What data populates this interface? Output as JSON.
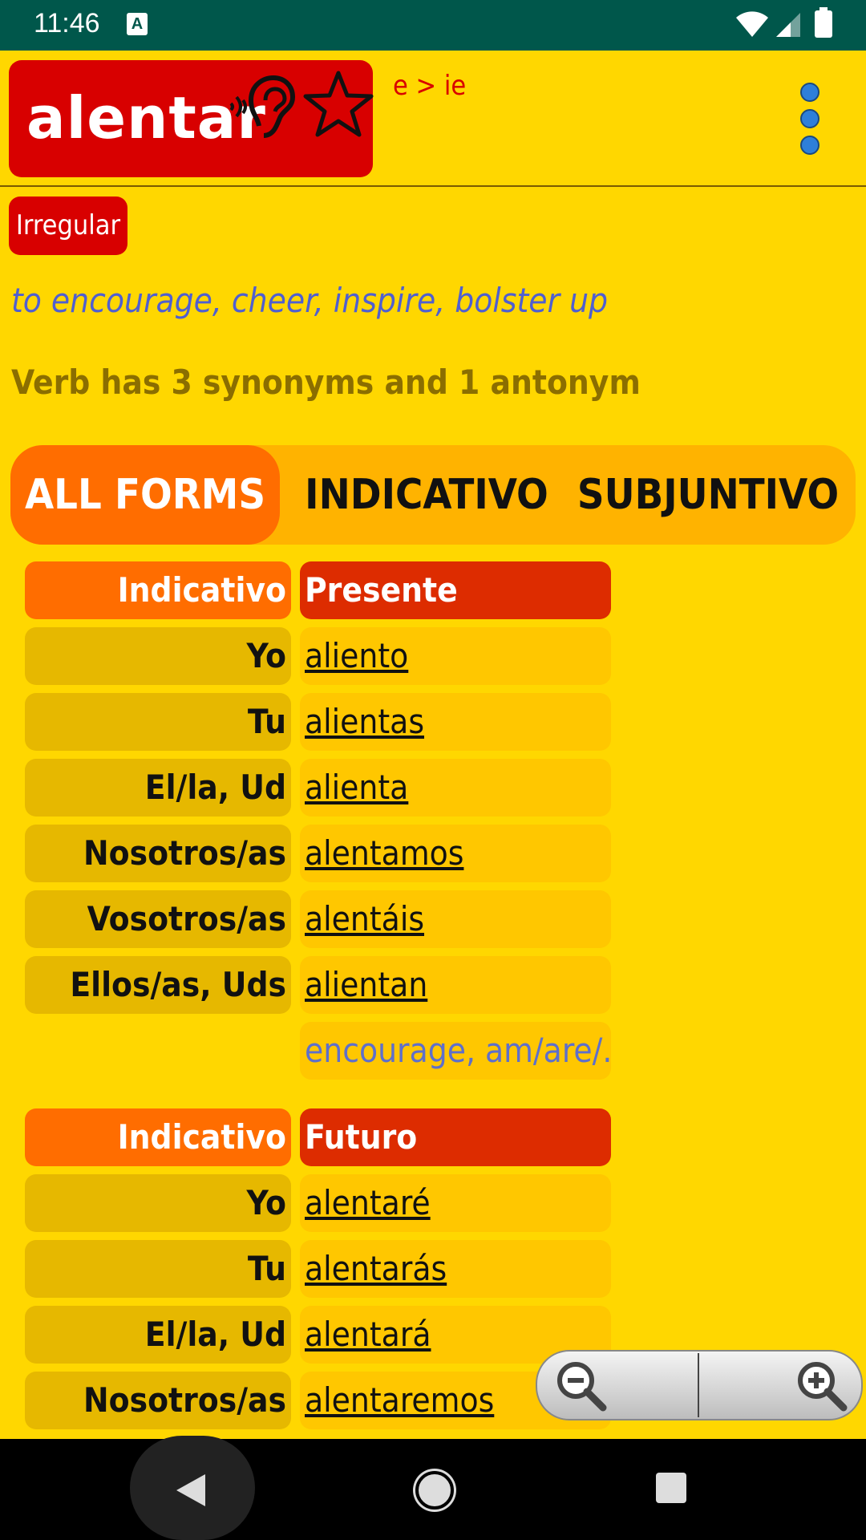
{
  "status_bar": {
    "time": "11:46",
    "notif_icon": "A"
  },
  "header": {
    "verb": "alentar",
    "stem_change": "e > ie"
  },
  "badge": "Irregular",
  "translation": "to encourage, cheer, inspire, bolster up",
  "synonyms_info": "Verb has 3 synonyms and 1 antonym",
  "tabs": [
    {
      "label": "ALL FORMS",
      "active": true
    },
    {
      "label": "INDICATIVO",
      "active": false
    },
    {
      "label": "SUBJUNTIVO",
      "active": false
    }
  ],
  "sections": [
    {
      "mood": "Indicativo",
      "tense": "Presente",
      "rows": [
        {
          "pronoun": "Yo",
          "form": "aliento"
        },
        {
          "pronoun": "Tu",
          "form": "alientas"
        },
        {
          "pronoun": "El/la, Ud",
          "form": "alienta"
        },
        {
          "pronoun": "Nosotros/as",
          "form": "alentamos"
        },
        {
          "pronoun": "Vosotros/as",
          "form": "alentáis"
        },
        {
          "pronoun": "Ellos/as, Uds",
          "form": "alientan"
        }
      ],
      "translation": "encourage, am/are/.."
    },
    {
      "mood": "Indicativo",
      "tense": "Futuro",
      "rows": [
        {
          "pronoun": "Yo",
          "form": "alentaré"
        },
        {
          "pronoun": "Tu",
          "form": "alentarás"
        },
        {
          "pronoun": "El/la, Ud",
          "form": "alentará"
        },
        {
          "pronoun": "Nosotros/as",
          "form": "alentaremos"
        }
      ]
    }
  ],
  "colors": {
    "background": "#FFD700",
    "accent_red": "#D80000",
    "tab_active": "#FF6D00",
    "status_bar": "#00574B"
  }
}
